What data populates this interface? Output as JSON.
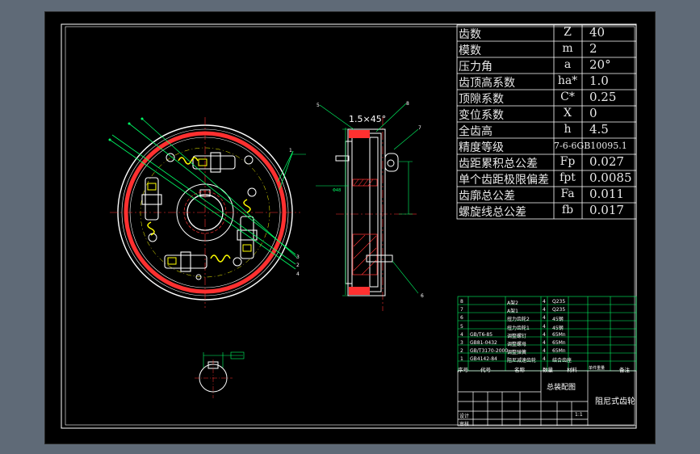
{
  "params": [
    {
      "name": "齿数",
      "symbol": "Z",
      "value": "40"
    },
    {
      "name": "模数",
      "symbol": "m",
      "value": "2"
    },
    {
      "name": "压力角",
      "symbol": "a",
      "value": "20°"
    },
    {
      "name": "齿顶高系数",
      "symbol": "ha*",
      "value": "1.0"
    },
    {
      "name": "顶隙系数",
      "symbol": "C*",
      "value": "0.25"
    },
    {
      "name": "变位系数",
      "symbol": "X",
      "value": "0"
    },
    {
      "name": "全齿高",
      "symbol": "h",
      "value": "4.5"
    },
    {
      "name": "精度等级",
      "symbol": "",
      "value": "7-6-6GB10095.1"
    },
    {
      "name": "齿距累积总公差",
      "symbol": "Fp",
      "value": "0.027"
    },
    {
      "name": "单个齿距极限偏差",
      "symbol": "fpt",
      "value": "0.0085"
    },
    {
      "name": "齿廓总公差",
      "symbol": "Fa",
      "value": "0.011"
    },
    {
      "name": "螺旋线总公差",
      "symbol": "fb",
      "value": "0.017"
    }
  ],
  "bom_rows": [
    {
      "no": "8",
      "code": "",
      "name": "A架2",
      "qty": "4",
      "mat": "Q235"
    },
    {
      "no": "7",
      "code": "",
      "name": "A架1",
      "qty": "4",
      "mat": "Q235"
    },
    {
      "no": "6",
      "code": "",
      "name": "扭力齿轮2",
      "qty": "4",
      "mat": "45钢"
    },
    {
      "no": "5",
      "code": "",
      "name": "扭力齿轮1",
      "qty": "4",
      "mat": "45钢"
    },
    {
      "no": "4",
      "code": "GB/T6-85",
      "name": "调整螺钉",
      "qty": "4",
      "mat": "65Mn"
    },
    {
      "no": "3",
      "code": "GB81-0432",
      "name": "调整螺母",
      "qty": "4",
      "mat": "65Mn"
    },
    {
      "no": "2",
      "code": "GB/T3170-2000",
      "name": "调整弹簧",
      "qty": "4",
      "mat": "65Mn"
    },
    {
      "no": "1",
      "code": "GB4142-84",
      "name": "阻尼减速齿轮",
      "qty": "4",
      "mat": "结合齿座"
    }
  ],
  "bom_header": [
    "序号",
    "代号",
    "名称",
    "数量",
    "材料",
    "单件重量",
    "备注"
  ],
  "title_block": {
    "drawing_name": "阻尼式齿轮",
    "assembly_label": "总装配图",
    "designer_row": "设计",
    "review_row": "审核",
    "scale_label": "1:1"
  },
  "dimensions": {
    "chamfer": "1.5×45°",
    "left_dim": "Φ48",
    "balloon_labels": [
      "1",
      "2",
      "3",
      "4",
      "5",
      "6",
      "7",
      "8"
    ]
  }
}
